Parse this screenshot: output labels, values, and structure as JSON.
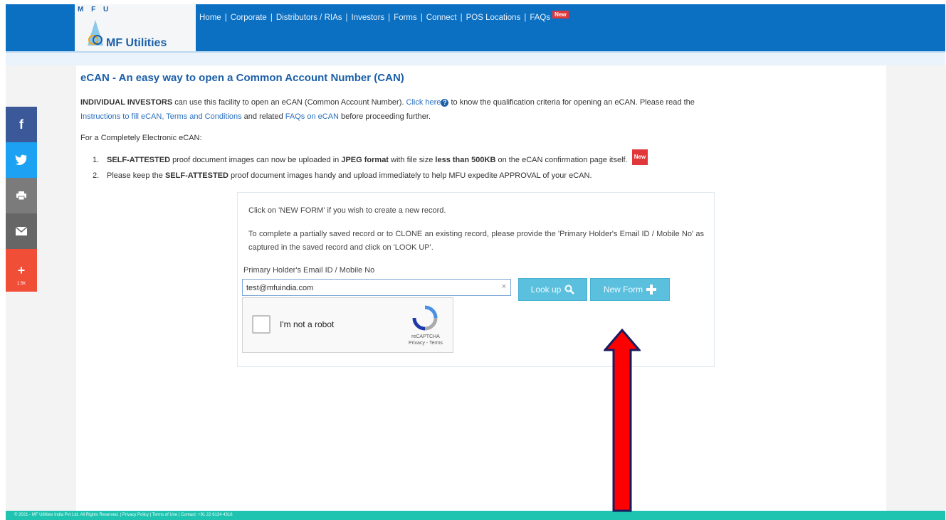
{
  "header": {
    "logo_top": "M F U",
    "logo_brand": "MF Utilities",
    "nav": [
      "Home",
      "Corporate",
      "Distributors / RIAs",
      "Investors",
      "Forms",
      "Connect",
      "POS Locations",
      "FAQs"
    ],
    "new_badge": "New"
  },
  "page": {
    "title": "eCAN - An easy way to open a Common Account Number (CAN)",
    "intro_bold": "INDIVIDUAL INVESTORS",
    "intro_text1": " can use this facility to open an eCAN (Common Account Number). ",
    "click_here": "Click here",
    "intro_text2": " to know the qualification criteria for opening an eCAN. Please read the ",
    "link_instructions": "Instructions to fill eCAN, Terms and Conditions",
    "intro_text3": " and related ",
    "link_faqs": "FAQs on eCAN",
    "intro_text4": " before proceeding further.",
    "for_line": "For a Completely Electronic eCAN:",
    "step1": {
      "num": "1.",
      "b1": "SELF-ATTESTED",
      "t1": " proof document images can now be uploaded in ",
      "b2": "JPEG format",
      "t2": " with file size ",
      "b3": "less than 500KB",
      "t3": " on the eCAN confirmation page itself."
    },
    "step2": {
      "num": "2.",
      "t1": "Please keep the ",
      "b1": "SELF-ATTESTED",
      "t2": " proof document images handy and upload immediately to help MFU expedite APPROVAL of your eCAN."
    }
  },
  "form": {
    "instruction1": "Click on 'NEW FORM' if you wish to create a new record.",
    "instruction2": "To complete a partially saved record or to CLONE an existing record, please provide the 'Primary Holder's Email ID / Mobile No' as captured in the saved record and click on 'LOOK UP'.",
    "field_label": "Primary Holder's Email ID / Mobile No",
    "field_value": "test@mfuindia.com",
    "clear_symbol": "×",
    "lookup_label": "Look up",
    "newform_label": "New Form",
    "captcha_label": "I'm not a robot",
    "captcha_brand": "reCAPTCHA",
    "captcha_links": "Privacy - Terms"
  },
  "social": {
    "facebook": "f",
    "plus": "+",
    "plus_count": "1.5K"
  },
  "footer": {
    "text": "© 2021 - MF Utilities India Pvt Ltd. All Rights Reserved. | Privacy Policy | Terms of Use | Contact: +91 22 6134 4316"
  },
  "colors": {
    "header_blue": "#0b6fc2",
    "button_cyan": "#5bc0de",
    "arrow_red": "#ff0000",
    "footer_teal": "#1ec4b0"
  }
}
